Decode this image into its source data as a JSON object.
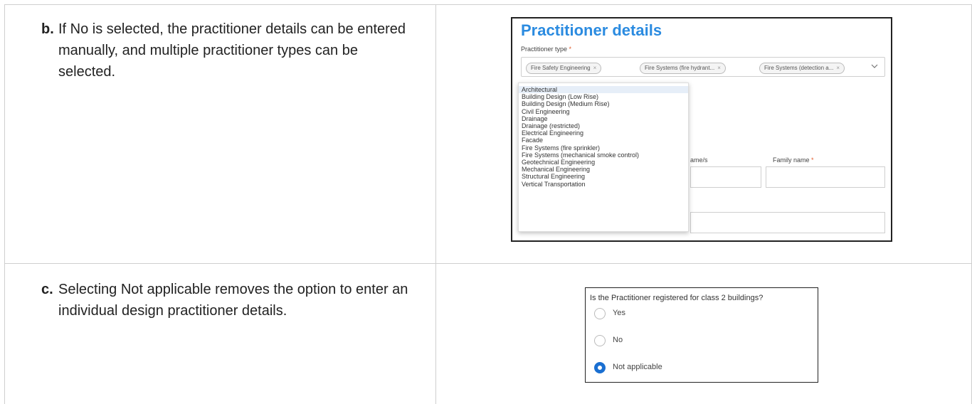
{
  "steps": [
    {
      "letter": "b.",
      "text": "If No is selected, the practitioner details can be entered manually, and multiple practitioner types can be selected."
    },
    {
      "letter": "c.",
      "text": "Selecting Not applicable removes the option to enter an individual design practitioner details."
    }
  ],
  "practitioner_panel": {
    "title": "Practitioner details",
    "type_label": "Practitioner type",
    "required_mark": "*",
    "selected_tags": [
      "Fire Safety Engineering",
      "Fire Systems (fire hydrant...",
      "Fire Systems (detection a..."
    ],
    "tag_remove": "×",
    "options": [
      "Architectural",
      "Building Design (Low Rise)",
      "Building Design (Medium Rise)",
      "Civil Engineering",
      "Drainage",
      "Drainage (restricted)",
      "Electrical Engineering",
      "Facade",
      "Fire Systems (fire sprinkler)",
      "Fire Systems (mechanical smoke control)",
      "Geotechnical Engineering",
      "Mechanical Engineering",
      "Structural Engineering",
      "Vertical Transportation"
    ],
    "given_names_label_partial": "ame/s",
    "family_name_label": "Family name"
  },
  "registration_question": {
    "question": "Is the Practitioner registered for class 2 buildings?",
    "options": [
      "Yes",
      "No",
      "Not applicable"
    ],
    "selected": "Not applicable"
  },
  "colors": {
    "title_blue": "#2b8be0",
    "radio_selected": "#1a6fd1",
    "required": "#e05a2a"
  }
}
